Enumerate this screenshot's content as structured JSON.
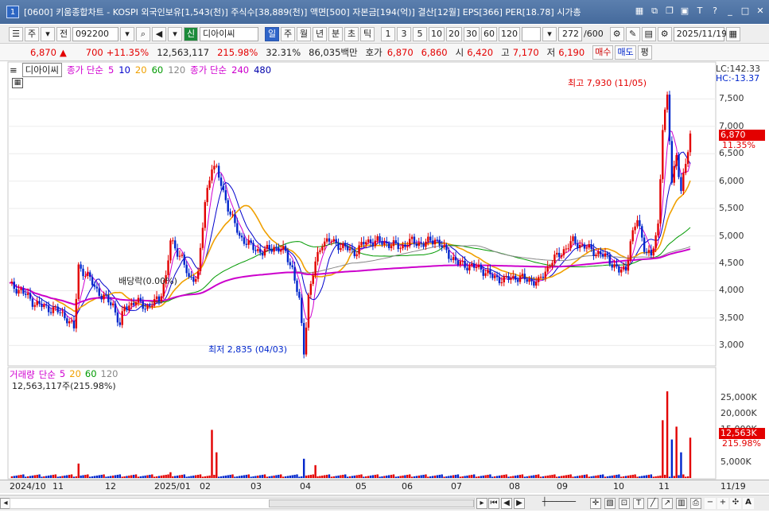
{
  "window": {
    "title": "[0600] 키움종합차트 - KOSPI 외국인보유[1,543(천)] 주식수[38,889(천)] 액면[500] 자본금[194(억)] 결산[12월] EPS[366] PER[18.78] 시가총",
    "badge": "1"
  },
  "toolbar": {
    "type_label": "주",
    "prev_label": "전",
    "code": "092200",
    "name_badge": "신",
    "name": "디아이씨",
    "periods": [
      "일",
      "주",
      "월",
      "년",
      "분",
      "초",
      "틱"
    ],
    "minutes": [
      "1",
      "3",
      "5",
      "10",
      "20",
      "30",
      "60",
      "120"
    ],
    "count": "272",
    "count_total": "/600",
    "date": "2025/11/19"
  },
  "quote": {
    "price": "6,870",
    "change_arrow": "▲",
    "change": "700",
    "change_pct": "+11.35%",
    "volume": "12,563,117",
    "vol_ratio": "215.98%",
    "turnover": "32.31%",
    "amount": "86,035백만",
    "bid_label": "호가",
    "ask": "6,870",
    "bid": "6,860",
    "open_label": "시",
    "open": "6,420",
    "high_label": "고",
    "high": "7,170",
    "low_label": "저",
    "low": "6,190",
    "buy": "매수",
    "sell": "매도",
    "eval": "평"
  },
  "price_legend": {
    "name": "디아이씨",
    "ma_label": "종가 단순",
    "ma": [
      "5",
      "10",
      "20",
      "60",
      "120"
    ],
    "ma2_label": "종가 단순",
    "ma2": [
      "240",
      "480"
    ]
  },
  "price_annotations": {
    "lc": "LC:142.33",
    "hc": "HC:-13.37",
    "high_note": "최고 7,930 (11/05)",
    "low_note": "최저 2,835 (04/03)",
    "dividend": "배당락(0.00%)",
    "current": "6,870",
    "current_pct": "11.35%"
  },
  "price_axis": [
    "7,500",
    "7,000",
    "6,500",
    "6,000",
    "5,500",
    "5,000",
    "4,500",
    "4,000",
    "3,500",
    "3,000"
  ],
  "volume_legend": {
    "name": "거래량",
    "ma_label": "단순",
    "ma": [
      "5",
      "20",
      "60",
      "120"
    ],
    "value": "12,563,117주(215.98%)"
  },
  "volume_axis": [
    "25,000K",
    "20,000K",
    "15,000K",
    "5,000K"
  ],
  "volume_current": "12,563K",
  "volume_pct": "215.98%",
  "date_axis": [
    "2024/10",
    "11",
    "12",
    "2025/01",
    "02",
    "03",
    "04",
    "05",
    "06",
    "07",
    "08",
    "09",
    "10",
    "11",
    "11/19"
  ],
  "colors": {
    "up": "#e30000",
    "down": "#0026cc",
    "ma5": "#d000d0",
    "ma10": "#0000cc",
    "ma20": "#f0a000",
    "ma60": "#009a00",
    "ma120": "#888888",
    "ma240": "#cc00cc",
    "ma480": "#0000aa"
  },
  "chart_data": {
    "type": "line",
    "title": "",
    "ylim": [
      2700,
      8000
    ],
    "series": [
      {
        "name": "",
        "points": [
          [
            0,
            4100
          ],
          [
            5,
            4000
          ],
          [
            10,
            3800
          ],
          [
            15,
            3700
          ],
          [
            20,
            3650
          ],
          [
            25,
            3500
          ],
          [
            28,
            3300
          ],
          [
            30,
            4450
          ],
          [
            35,
            4200
          ],
          [
            40,
            3900
          ],
          [
            45,
            3750
          ],
          [
            48,
            3350
          ],
          [
            50,
            3700
          ],
          [
            55,
            3800
          ],
          [
            60,
            3700
          ],
          [
            65,
            3850
          ],
          [
            68,
            4250
          ],
          [
            70,
            4900
          ],
          [
            75,
            4600
          ],
          [
            78,
            4200
          ],
          [
            82,
            4300
          ],
          [
            85,
            5600
          ],
          [
            88,
            6300
          ],
          [
            90,
            6200
          ],
          [
            93,
            5800
          ],
          [
            96,
            5400
          ],
          [
            100,
            5000
          ],
          [
            105,
            4800
          ],
          [
            110,
            4700
          ],
          [
            115,
            4800
          ],
          [
            120,
            4700
          ],
          [
            123,
            4400
          ],
          [
            126,
            3800
          ],
          [
            128,
            2900
          ],
          [
            130,
            3900
          ],
          [
            133,
            4500
          ],
          [
            136,
            4900
          ],
          [
            140,
            4900
          ],
          [
            145,
            4800
          ],
          [
            150,
            4700
          ],
          [
            155,
            4900
          ],
          [
            160,
            4900
          ],
          [
            165,
            4850
          ],
          [
            170,
            4800
          ],
          [
            175,
            4900
          ],
          [
            180,
            4850
          ],
          [
            185,
            4950
          ],
          [
            190,
            4700
          ],
          [
            195,
            4500
          ],
          [
            200,
            4450
          ],
          [
            205,
            4400
          ],
          [
            210,
            4250
          ],
          [
            215,
            4200
          ],
          [
            220,
            4250
          ],
          [
            225,
            4200
          ],
          [
            230,
            4150
          ],
          [
            235,
            4500
          ],
          [
            240,
            4700
          ],
          [
            245,
            4900
          ],
          [
            250,
            4800
          ],
          [
            255,
            4700
          ],
          [
            260,
            4600
          ],
          [
            265,
            4350
          ],
          [
            268,
            4400
          ],
          [
            270,
            4900
          ],
          [
            273,
            5300
          ],
          [
            276,
            4800
          ],
          [
            279,
            4600
          ],
          [
            282,
            5200
          ],
          [
            284,
            7000
          ],
          [
            286,
            7500
          ],
          [
            288,
            6000
          ],
          [
            290,
            6500
          ],
          [
            292,
            5800
          ],
          [
            294,
            6300
          ],
          [
            296,
            6870
          ]
        ]
      }
    ]
  }
}
